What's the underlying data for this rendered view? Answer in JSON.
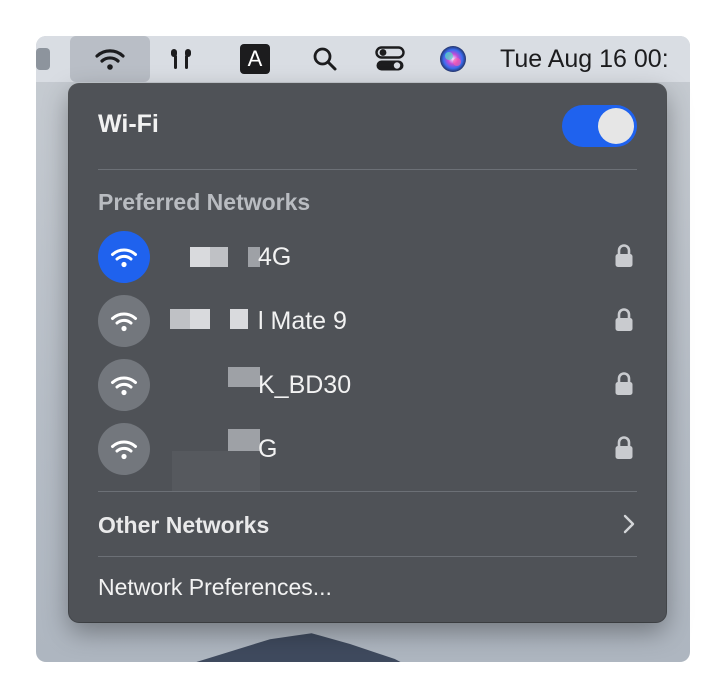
{
  "menubar": {
    "clock": "Tue Aug 16  00:",
    "input_source_label": "A",
    "icons": [
      "wifi-icon",
      "airpods-icon",
      "input-source-icon",
      "search-icon",
      "control-center-icon",
      "siri-icon"
    ]
  },
  "wifi_panel": {
    "title": "Wi-Fi",
    "wifi_enabled": true,
    "preferred_label": "Preferred Networks",
    "networks": [
      {
        "name": "4G",
        "connected": true,
        "secured": true
      },
      {
        "name": "l Mate 9",
        "connected": false,
        "secured": true
      },
      {
        "name": "K_BD30",
        "connected": false,
        "secured": true
      },
      {
        "name": "G",
        "connected": false,
        "secured": true
      }
    ],
    "other_networks_label": "Other Networks",
    "preferences_label": "Network Preferences..."
  },
  "colors": {
    "accent": "#1f62ee",
    "panel_bg": "#4f5257",
    "inactive_circle": "#73777d"
  }
}
